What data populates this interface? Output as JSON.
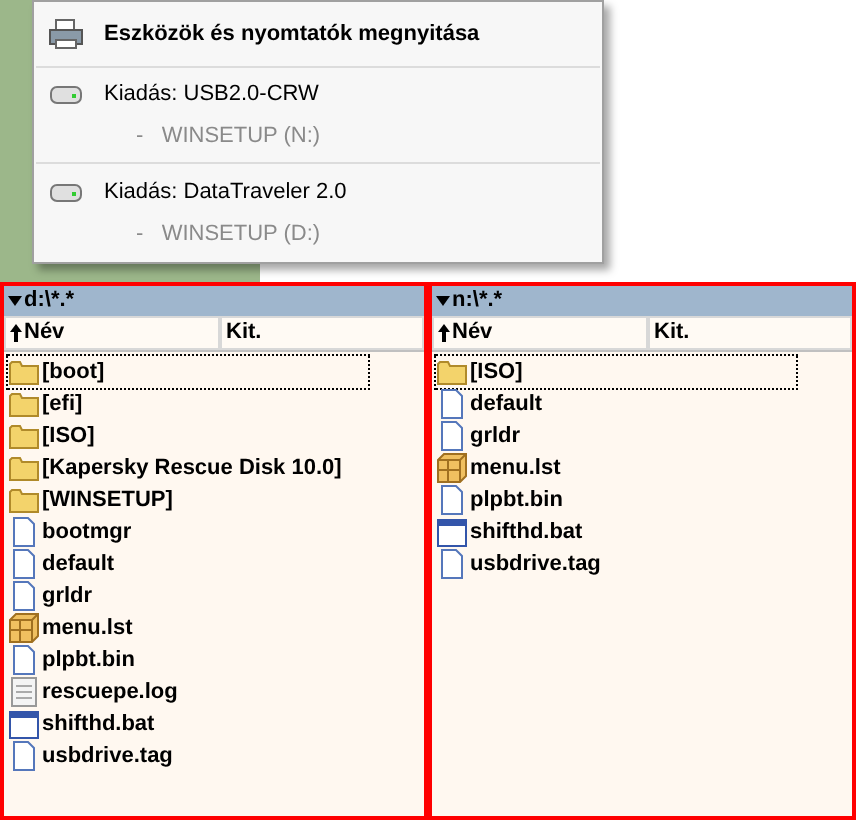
{
  "popup": {
    "title": "Eszközök és nyomtatók megnyitása",
    "devices": [
      {
        "label": "Kiadás: USB2.0-CRW",
        "volume": "-   WINSETUP (N:)"
      },
      {
        "label": "Kiadás: DataTraveler 2.0",
        "volume": "-   WINSETUP (D:)"
      }
    ]
  },
  "panels": [
    {
      "path": "d:\\*.*",
      "columns": [
        "Név",
        "Kit."
      ],
      "files": [
        {
          "name": "[boot]",
          "kind": "folder",
          "focused": true
        },
        {
          "name": "[efi]",
          "kind": "folder",
          "focused": false
        },
        {
          "name": "[ISO]",
          "kind": "folder",
          "focused": false
        },
        {
          "name": "[Kapersky Rescue Disk 10.0]",
          "kind": "folder",
          "focused": false
        },
        {
          "name": "[WINSETUP]",
          "kind": "folder",
          "focused": false
        },
        {
          "name": "bootmgr",
          "kind": "file",
          "focused": false
        },
        {
          "name": "default",
          "kind": "file",
          "focused": false
        },
        {
          "name": "grldr",
          "kind": "file",
          "focused": false
        },
        {
          "name": "menu.lst",
          "kind": "config",
          "focused": false
        },
        {
          "name": "plpbt.bin",
          "kind": "file",
          "focused": false
        },
        {
          "name": "rescuepe.log",
          "kind": "log",
          "focused": false
        },
        {
          "name": "shifthd.bat",
          "kind": "bat",
          "focused": false
        },
        {
          "name": "usbdrive.tag",
          "kind": "file",
          "focused": false
        }
      ]
    },
    {
      "path": "n:\\*.*",
      "columns": [
        "Név",
        "Kit."
      ],
      "files": [
        {
          "name": "[ISO]",
          "kind": "folder",
          "focused": true
        },
        {
          "name": "default",
          "kind": "file",
          "focused": false
        },
        {
          "name": "grldr",
          "kind": "file",
          "focused": false
        },
        {
          "name": "menu.lst",
          "kind": "config",
          "focused": false
        },
        {
          "name": "plpbt.bin",
          "kind": "file",
          "focused": false
        },
        {
          "name": "shifthd.bat",
          "kind": "bat",
          "focused": false
        },
        {
          "name": "usbdrive.tag",
          "kind": "file",
          "focused": false
        }
      ]
    }
  ]
}
